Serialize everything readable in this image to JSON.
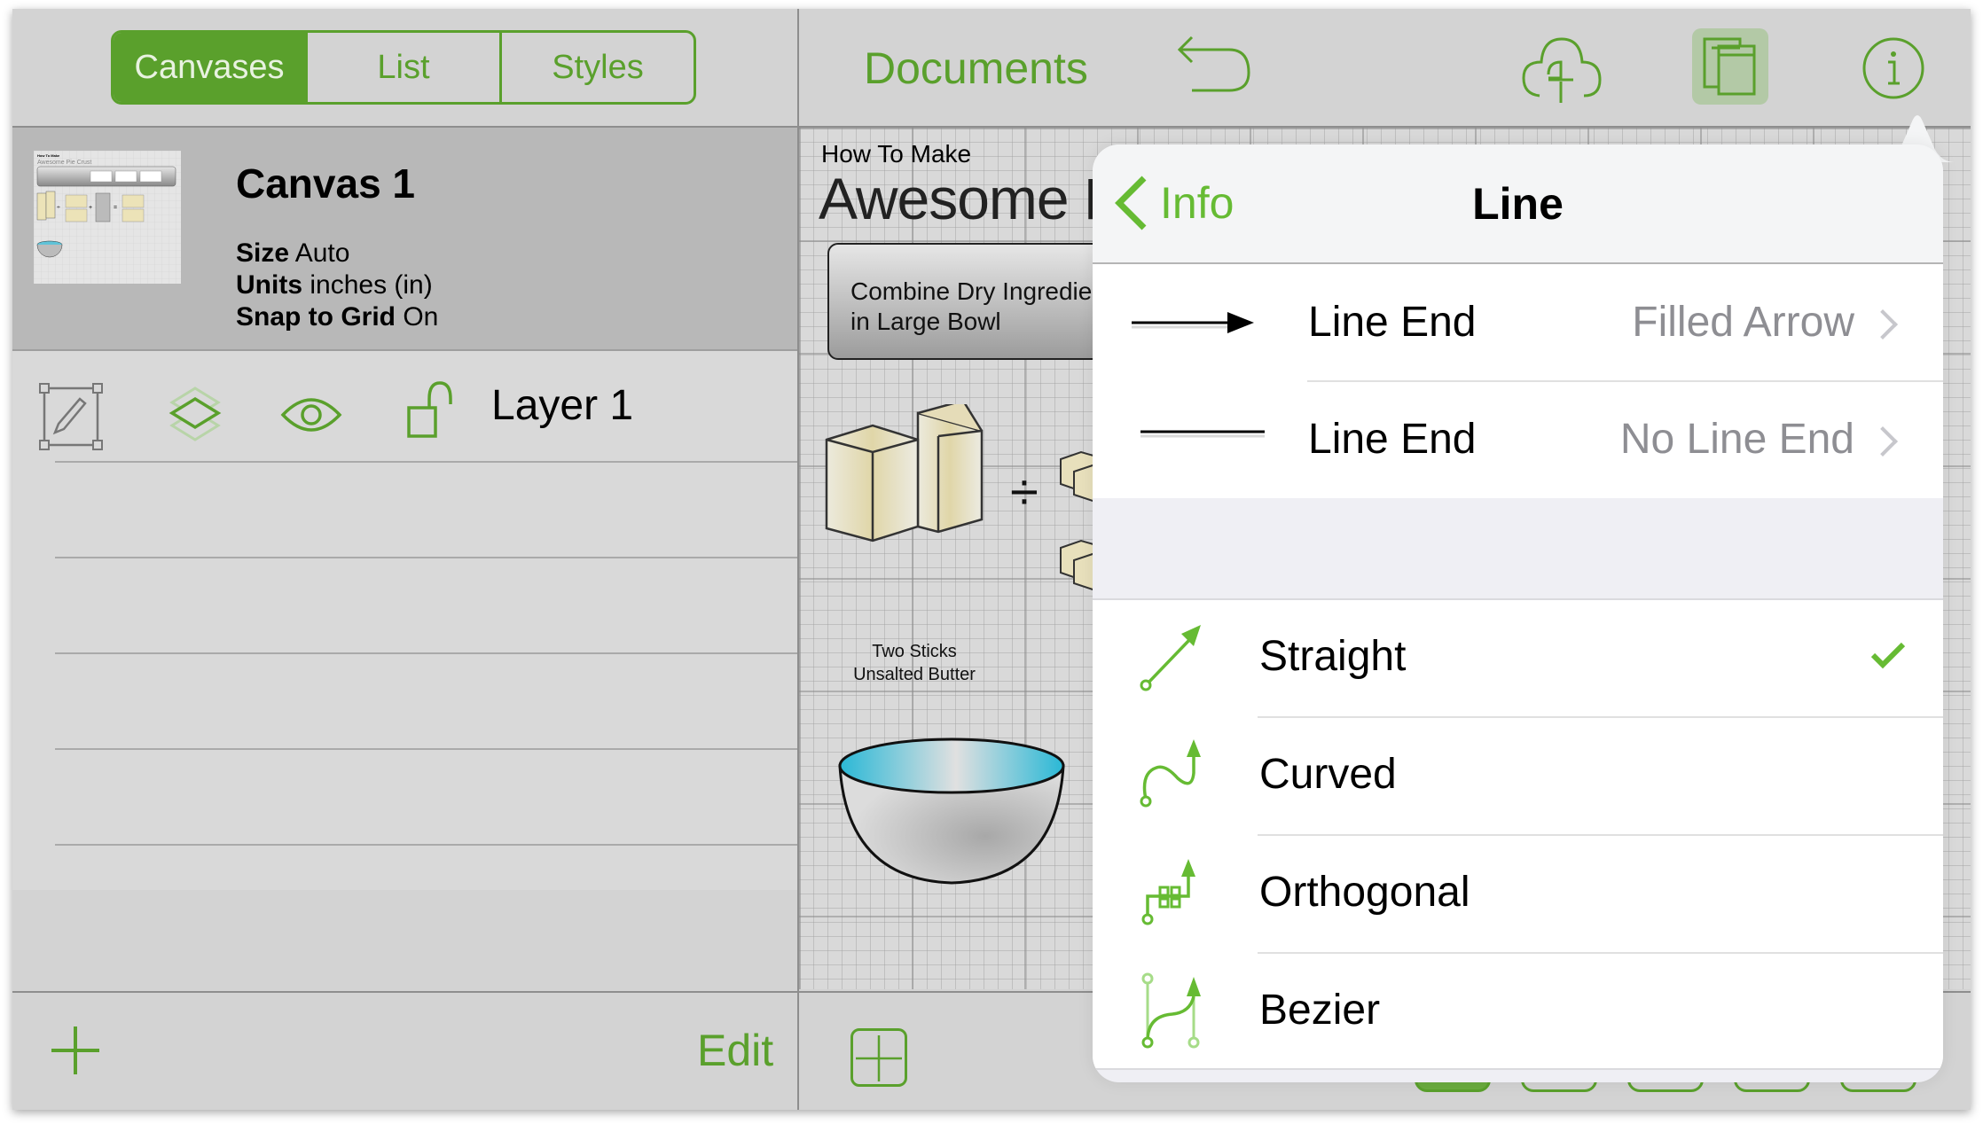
{
  "sidebar": {
    "segments": [
      {
        "label": "Canvases",
        "active": true
      },
      {
        "label": "List",
        "active": false
      },
      {
        "label": "Styles",
        "active": false
      }
    ],
    "canvas": {
      "title": "Canvas 1",
      "size_label": "Size",
      "size_value": "Auto",
      "units_label": "Units",
      "units_value": "inches (in)",
      "snap_label": "Snap to Grid",
      "snap_value": "On"
    },
    "layer": {
      "name": "Layer 1",
      "icons": [
        "edit-layer-icon",
        "layers-icon",
        "eye-icon",
        "unlock-icon"
      ]
    },
    "footer": {
      "add_icon": "plus-icon",
      "edit_label": "Edit"
    }
  },
  "toolbar": {
    "documents_label": "Documents",
    "icons": [
      "undo-icon",
      "cloud-sync-icon",
      "canvases-icon",
      "info-icon"
    ]
  },
  "canvas_content": {
    "heading_small": "How To Make",
    "heading_large": "Awesome P",
    "step_box": "Combine Dry Ingredients in Large Bowl",
    "step_line1": "Combine Dry Ingredie",
    "step_line2": "in Large Bowl",
    "divide_symbol": "÷",
    "butter_caption_line1": "Two Sticks",
    "butter_caption_line2": "Unsalted Butter"
  },
  "popover": {
    "back_label": "Info",
    "title": "Line",
    "line_ends": [
      {
        "label": "Line End",
        "value": "Filled Arrow",
        "icon": "filled-arrow-line-icon"
      },
      {
        "label": "Line End",
        "value": "No Line End",
        "icon": "plain-line-icon"
      }
    ],
    "line_types": [
      {
        "label": "Straight",
        "icon": "straight-line-icon",
        "selected": true
      },
      {
        "label": "Curved",
        "icon": "curved-line-icon",
        "selected": false
      },
      {
        "label": "Orthogonal",
        "icon": "orthogonal-line-icon",
        "selected": false
      },
      {
        "label": "Bezier",
        "icon": "bezier-line-icon",
        "selected": false
      }
    ]
  },
  "colors": {
    "accent": "#5aa02c",
    "icon_green": "#66bb33",
    "toolbar_bg": "#d3d3d3",
    "selected_row_bg": "#b8b8b8"
  }
}
